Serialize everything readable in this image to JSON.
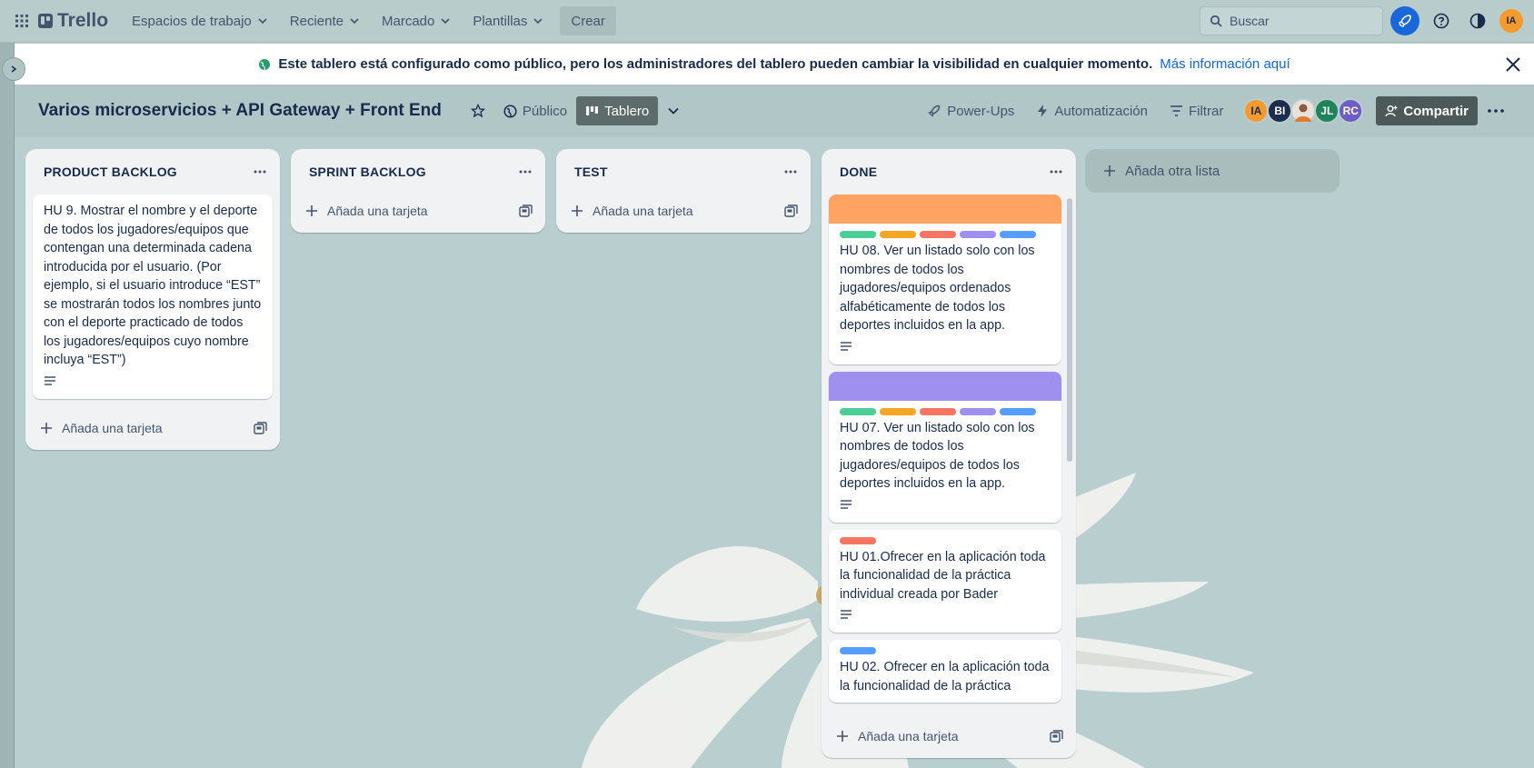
{
  "topnav": {
    "logo": "Trello",
    "menu": [
      {
        "label": "Espacios de trabajo"
      },
      {
        "label": "Reciente"
      },
      {
        "label": "Marcado"
      },
      {
        "label": "Plantillas"
      }
    ],
    "create_label": "Crear",
    "search_placeholder": "Buscar",
    "user_initials": "IA"
  },
  "banner": {
    "text": "Este tablero está configurado como público, pero los administradores del tablero pueden cambiar la visibilidad en cualquier momento.",
    "link": "Más información aquí"
  },
  "board": {
    "title": "Varios microservicios + API Gateway + Front End",
    "visibility": "Público",
    "view": "Tablero",
    "powerups": "Power-Ups",
    "automation": "Automatización",
    "filter": "Filtrar",
    "share": "Compartir",
    "members": [
      {
        "initials": "IA",
        "color": "#f79a2e"
      },
      {
        "initials": "BI",
        "color": "#1d2b4f"
      },
      {
        "initials": "",
        "color": "#e8e2da"
      },
      {
        "initials": "JL",
        "color": "#1f845a"
      },
      {
        "initials": "RC",
        "color": "#6e5dc6"
      }
    ]
  },
  "lists": [
    {
      "title": "PRODUCT BACKLOG",
      "cards": [
        {
          "text": "HU 9. Mostrar el nombre y el deporte de todos los jugadores/equipos que contengan una determinada cadena introducida por el usuario. (Por ejemplo, si el usuario introduce “EST” se mostrarán todos los nombres junto con el deporte practicado de todos los jugadores/equipos cuyo nombre incluya “EST”)"
        }
      ],
      "add_card": "Añada una tarjeta"
    },
    {
      "title": "SPRINT BACKLOG",
      "cards": [],
      "add_card": "Añada una tarjeta"
    },
    {
      "title": "TEST",
      "cards": [],
      "add_card": "Añada una tarjeta"
    },
    {
      "title": "DONE",
      "cards": [
        {
          "cover": "#fea362",
          "labels": [
            "#4bce97",
            "#f5a623",
            "#f87462",
            "#9f8fef",
            "#579dff"
          ],
          "text": "HU 08. Ver un listado solo con los nombres de todos los jugadores/equipos ordenados alfabéticamente de todos los deportes incluidos en la app."
        },
        {
          "cover": "#9f8fef",
          "labels": [
            "#4bce97",
            "#f5a623",
            "#f87462",
            "#9f8fef",
            "#579dff"
          ],
          "text": "HU 07. Ver un listado solo con los nombres de todos los jugadores/equipos de todos los deportes incluidos en la app."
        },
        {
          "labels": [
            "#f87462"
          ],
          "text": "HU 01.Ofrecer en la aplicación toda la funcionalidad de la práctica individual creada por Bader"
        },
        {
          "labels": [
            "#579dff"
          ],
          "text": "HU 02. Ofrecer en la aplicación toda la funcionalidad de la práctica"
        }
      ],
      "add_card": "Añada una tarjeta"
    }
  ],
  "add_list": "Añada otra lista",
  "colors": {
    "accent": "#0c66e4",
    "background": "#b9cfcf"
  }
}
